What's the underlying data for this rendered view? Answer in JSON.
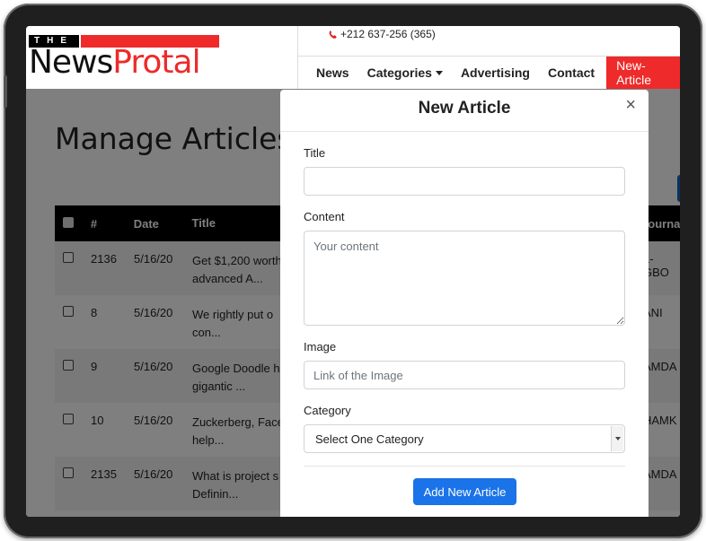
{
  "header": {
    "logo_the": "THE",
    "logo_news": "News",
    "logo_protal": "Protal",
    "phone": "+212 637-256 (365)"
  },
  "nav": {
    "items": [
      {
        "label": "News"
      },
      {
        "label": "Categories"
      },
      {
        "label": "Advertising"
      },
      {
        "label": "Contact"
      }
    ],
    "cta_label": "New-Article"
  },
  "page": {
    "title": "Manage Articles",
    "table": {
      "headers": [
        "#",
        "Date",
        "Title",
        "Journal"
      ],
      "rows": [
        {
          "id": "2136",
          "date": "5/16/20",
          "title_1": "Get $1,200 worth",
          "title_2": "advanced A...",
          "journal": "L-GBO"
        },
        {
          "id": "8",
          "date": "5/16/20",
          "title_1": "We rightly put o",
          "title_2": "con...",
          "journal": "ANI"
        },
        {
          "id": "9",
          "date": "5/16/20",
          "title_1": "Google Doodle h",
          "title_2": "gigantic ...",
          "journal": "AMDA"
        },
        {
          "id": "10",
          "date": "5/16/20",
          "title_1": "Zuckerberg, Face",
          "title_2": "help...",
          "journal": "HAMK"
        },
        {
          "id": "2135",
          "date": "5/16/20",
          "title_1": "What is project s",
          "title_2": "Definin...",
          "journal": "AMDA"
        }
      ]
    }
  },
  "modal": {
    "title": "New Article",
    "close_label": "×",
    "title_field": {
      "label": "Title",
      "value": "",
      "placeholder": ""
    },
    "content_field": {
      "label": "Content",
      "placeholder": "Your content"
    },
    "image_field": {
      "label": "Image",
      "placeholder": "Link of the Image"
    },
    "category_field": {
      "label": "Category",
      "selected": "Select One Category"
    },
    "submit_label": "Add New Article"
  },
  "colors": {
    "brand_red": "#ee2a2a",
    "primary_blue": "#1a73e8"
  }
}
